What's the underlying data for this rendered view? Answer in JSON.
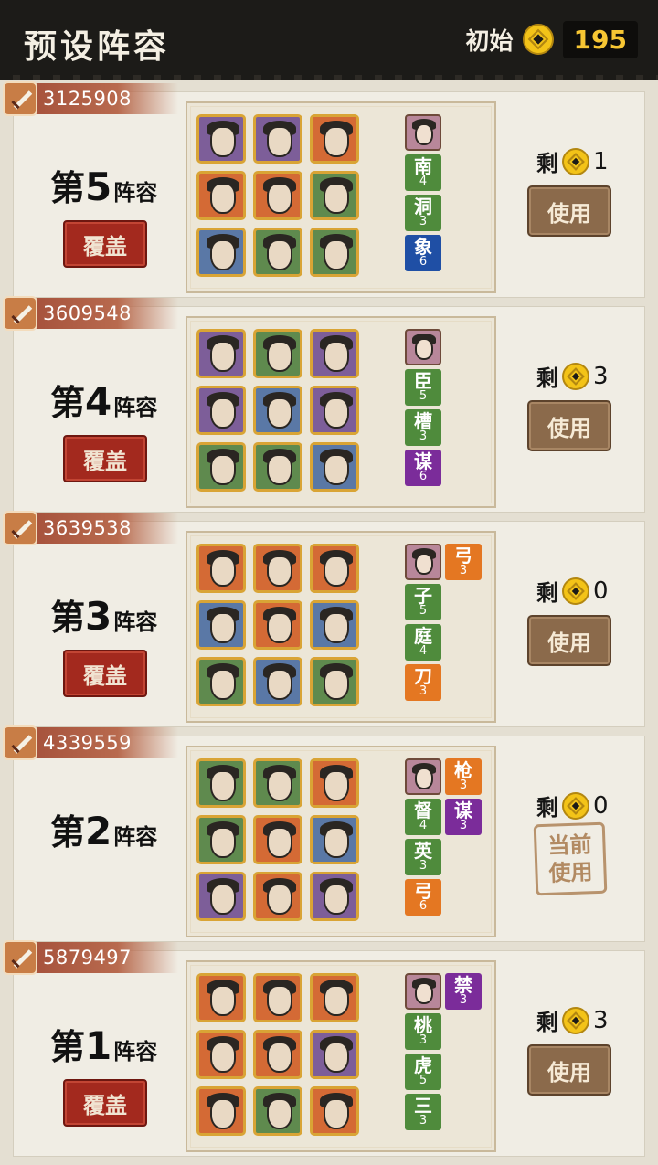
{
  "header": {
    "title": "预设阵容",
    "coins_label": "初始",
    "coins_value": "195"
  },
  "labels": {
    "di": "第",
    "zhenrong": "阵容",
    "cover": "覆盖",
    "use": "使用",
    "remain": "剩",
    "current": "当前使用"
  },
  "cards": [
    {
      "power": "3125908",
      "team_num": "5",
      "remain": "1",
      "current": false,
      "heroes": [
        "purple",
        "purple",
        "orange",
        "orange",
        "orange",
        "green",
        "blue",
        "green",
        "green"
      ],
      "tags": [
        {
          "ch": "南",
          "n": "4",
          "color": "green"
        },
        {
          "ch": "洞",
          "n": "3",
          "color": "green"
        },
        {
          "ch": "象",
          "n": "6",
          "color": "blue"
        }
      ],
      "side_tags": []
    },
    {
      "power": "3609548",
      "team_num": "4",
      "remain": "3",
      "current": false,
      "heroes": [
        "purple",
        "green",
        "purple",
        "purple",
        "blue",
        "purple",
        "green",
        "green",
        "blue"
      ],
      "tags": [
        {
          "ch": "臣",
          "n": "5",
          "color": "green"
        },
        {
          "ch": "槽",
          "n": "3",
          "color": "green"
        },
        {
          "ch": "谋",
          "n": "6",
          "color": "purple"
        }
      ],
      "side_tags": []
    },
    {
      "power": "3639538",
      "team_num": "3",
      "remain": "0",
      "current": false,
      "heroes": [
        "orange",
        "orange",
        "orange",
        "blue",
        "orange",
        "blue",
        "green",
        "blue",
        "green"
      ],
      "tags": [
        {
          "ch": "子",
          "n": "5",
          "color": "green"
        },
        {
          "ch": "庭",
          "n": "4",
          "color": "green"
        },
        {
          "ch": "刀",
          "n": "3",
          "color": "orange"
        }
      ],
      "side_tags": [
        {
          "ch": "弓",
          "n": "3",
          "color": "orange"
        }
      ]
    },
    {
      "power": "4339559",
      "team_num": "2",
      "remain": "0",
      "current": true,
      "heroes": [
        "green",
        "green",
        "orange",
        "green",
        "orange",
        "blue",
        "purple",
        "orange",
        "purple"
      ],
      "tags": [
        {
          "ch": "督",
          "n": "4",
          "color": "green"
        },
        {
          "ch": "英",
          "n": "3",
          "color": "green"
        },
        {
          "ch": "弓",
          "n": "6",
          "color": "orange"
        }
      ],
      "side_tags": [
        {
          "ch": "枪",
          "n": "3",
          "color": "orange"
        },
        {
          "ch": "谋",
          "n": "3",
          "color": "purple"
        }
      ]
    },
    {
      "power": "5879497",
      "team_num": "1",
      "remain": "3",
      "current": false,
      "heroes": [
        "orange",
        "orange",
        "orange",
        "orange",
        "orange",
        "purple",
        "orange",
        "green",
        "orange"
      ],
      "tags": [
        {
          "ch": "桃",
          "n": "3",
          "color": "green"
        },
        {
          "ch": "虎",
          "n": "5",
          "color": "green"
        },
        {
          "ch": "三",
          "n": "3",
          "color": "green"
        }
      ],
      "side_tags": [
        {
          "ch": "禁",
          "n": "3",
          "color": "purple"
        }
      ]
    }
  ]
}
